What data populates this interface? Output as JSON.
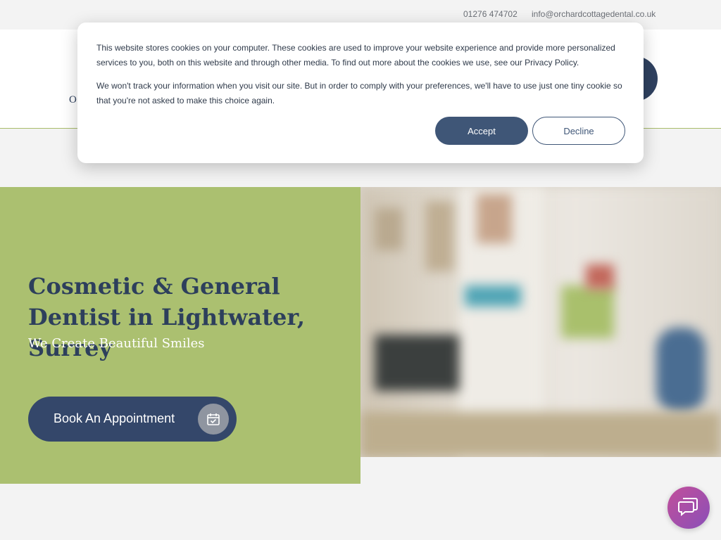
{
  "topbar": {
    "phone": "01276 474702",
    "email": "info@orchardcottagedental.co.uk"
  },
  "header": {
    "logo_fragment": "O"
  },
  "cookie_banner": {
    "paragraph_1": "This website stores cookies on your computer. These cookies are used to improve your website experience and provide more personalized services to you, both on this website and through other media. To find out more about the cookies we use, see our Privacy Policy.",
    "paragraph_2": "We won't track your information when you visit our site. But in order to comply with your preferences, we'll have to use just one tiny cookie so that you're not asked to make this choice again.",
    "accept_label": "Accept",
    "decline_label": "Decline"
  },
  "hero": {
    "title": "Cosmetic & General Dentist in Lightwater, Surrey",
    "subtitle": "We Create Beautiful Smiles",
    "book_button_label": "Book An Appointment"
  },
  "icons": {
    "book_button_icon": "calendar-check-icon",
    "chat_icon": "chat-bubbles-icon"
  },
  "colors": {
    "brand_green": "#abc070",
    "brand_navy": "#2d3f5c",
    "chat_gradient_start": "#c24f9a",
    "chat_gradient_end": "#8a4fb8"
  }
}
